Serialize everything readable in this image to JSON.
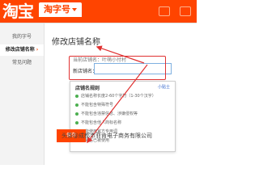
{
  "header": {
    "logo_text": "淘宝",
    "tab_label": "淘字号",
    "brand_color": "#ff4400"
  },
  "sidebar": {
    "items": [
      {
        "label": "我的字号",
        "active": false
      },
      {
        "label": "修改店铺名称",
        "active": true
      },
      {
        "label": "常见问题",
        "active": false
      }
    ]
  },
  "main": {
    "title": "修改店铺名称",
    "current_name_label": "当前店铺名：叶萌小付村",
    "input_label": "新店铺名：",
    "input_value": ""
  },
  "rules_panel": {
    "title": "店铺名规则",
    "link": "小贴士",
    "rules": [
      "店铺名称长度2-60个字符（1-30个汉字）",
      "不能包含特殊符号",
      "不能包含违禁信息、涉嫌侵权等",
      "不能包含他人商标名称",
      "不能使用官方专用词",
      "店铺名已被使用"
    ],
    "dot_color": "#4caf50"
  },
  "footer": {
    "save_label": "保存",
    "watermark": "头条@成都市菲肯电子商务有限公司"
  },
  "annotation": {
    "color": "#e03131"
  }
}
